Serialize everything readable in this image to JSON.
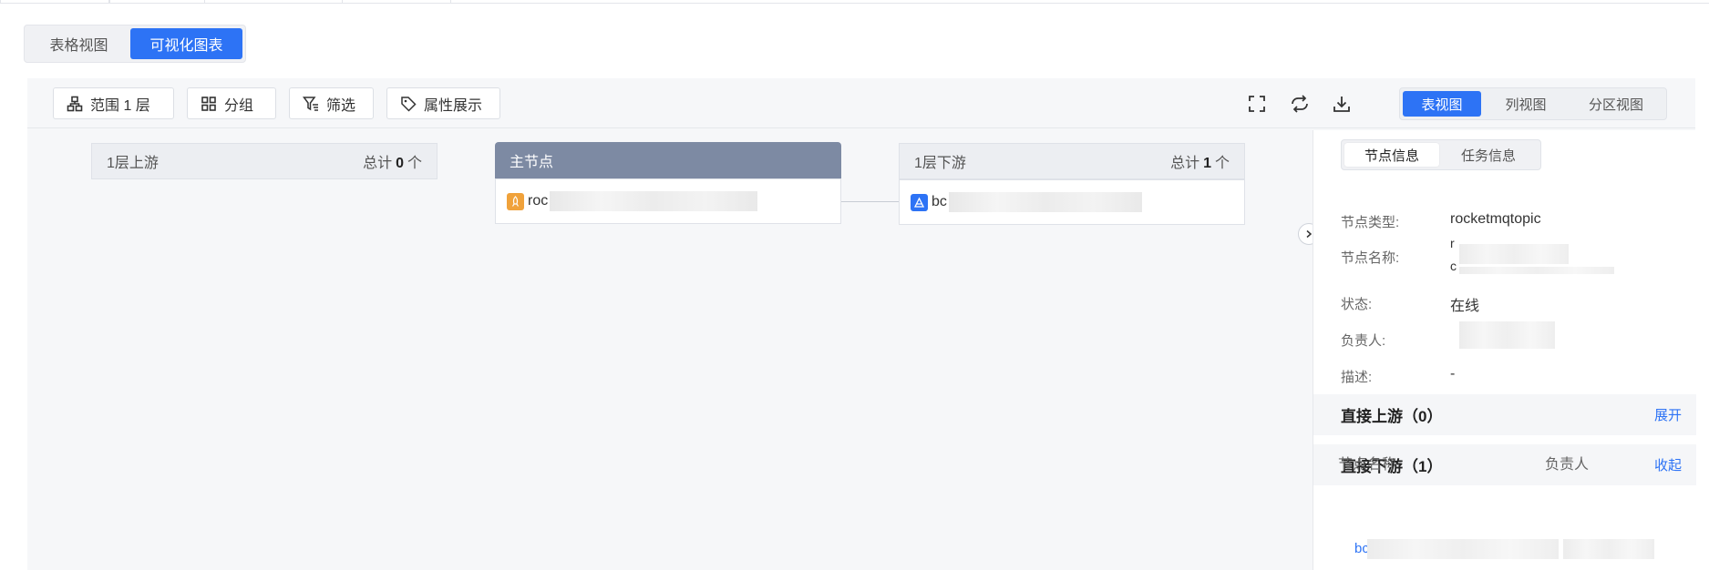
{
  "view_switch": {
    "table_label": "表格视图",
    "chart_label": "可视化图表"
  },
  "toolbar": {
    "range_label": "范围 1 层",
    "group_label": "分组",
    "filter_label": "筛选",
    "attr_label": "属性展示",
    "modes": [
      "表视图",
      "列视图",
      "分区视图"
    ]
  },
  "upstream": {
    "title": "1层上游",
    "total_prefix": "总计",
    "total_count": "0",
    "total_suffix": "个"
  },
  "main_node": {
    "title": "主节点",
    "node_name_visible": "roc"
  },
  "downstream": {
    "title": "1层下游",
    "total_prefix": "总计",
    "total_count": "1",
    "total_suffix": "个",
    "node_name_visible": "bc"
  },
  "panel": {
    "tabs": [
      "节点信息",
      "任务信息"
    ],
    "fields": {
      "type_label": "节点类型:",
      "type_value": "rocketmqtopic",
      "name_label": "节点名称:",
      "name_value_line1": "r",
      "name_value_line2": "c",
      "status_label": "状态:",
      "status_value": "在线",
      "owner_label": "负责人:",
      "desc_label": "描述:",
      "desc_value": "-"
    },
    "upstream_section": {
      "title": "直接上游（0）",
      "action": "展开"
    },
    "downstream_section": {
      "title": "直接下游（1）",
      "action": "收起"
    },
    "table": {
      "col_name": "节点名称",
      "col_owner": "负责人",
      "row_name_visible": "bc"
    }
  },
  "colors": {
    "primary": "#2d73f5",
    "main_node_header": "#7d8aa3",
    "topic_icon": "#f0a23b",
    "task_icon": "#2d73f5"
  }
}
